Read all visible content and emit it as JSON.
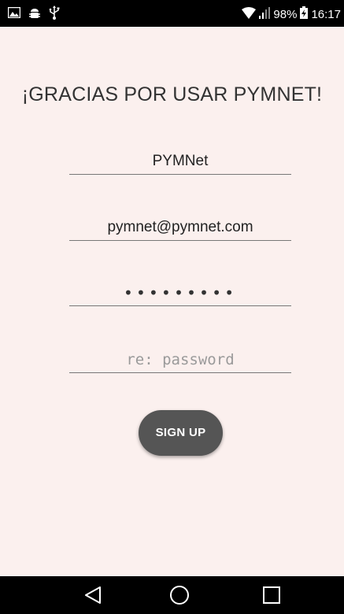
{
  "status_bar": {
    "left_icons": [
      "image-icon",
      "android-debug-icon",
      "usb-icon"
    ],
    "battery_percent": "98%",
    "time": "16:17"
  },
  "form": {
    "title": "¡GRACIAS POR USAR PYMNET!",
    "username_value": "PYMNet",
    "email_value": "pymnet@pymnet.com",
    "password_value": "•••••••••",
    "repassword_placeholder": "re: password",
    "signup_label": "SIGN UP"
  },
  "nav_bar": {
    "buttons": [
      "back-icon",
      "home-icon",
      "recents-icon"
    ]
  },
  "colors": {
    "background": "#fbf0ee",
    "button": "#555555",
    "bars": "#000000"
  }
}
